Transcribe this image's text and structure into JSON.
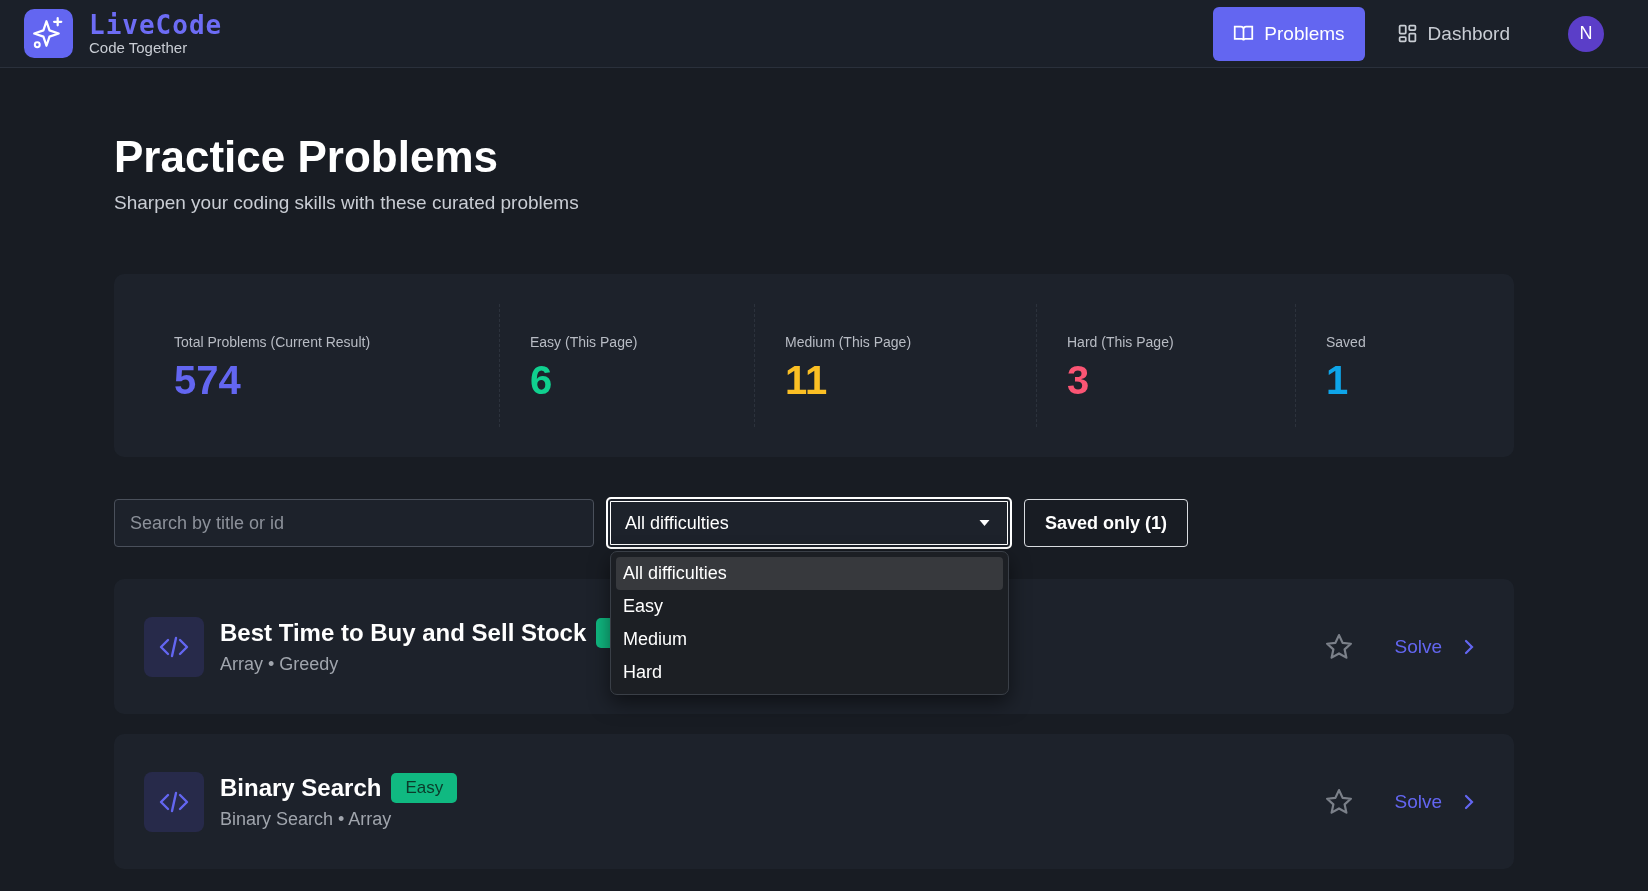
{
  "brand": {
    "name": "LiveCode",
    "tagline": "Code Together"
  },
  "nav": [
    {
      "label": "Problems",
      "selected": true
    },
    {
      "label": "Dashbord",
      "selected": false
    }
  ],
  "avatar": {
    "initial": "N"
  },
  "page": {
    "title": "Practice Problems",
    "subtitle": "Sharpen your coding skills with these curated problems"
  },
  "stats": [
    {
      "label": "Total Problems (Current Result)",
      "value": "574",
      "color": "#6366f1"
    },
    {
      "label": "Easy (This Page)",
      "value": "6",
      "color": "#10d08f"
    },
    {
      "label": "Medium (This Page)",
      "value": "11",
      "color": "#fbbf24"
    },
    {
      "label": "Hard (This Page)",
      "value": "3",
      "color": "#fb5574"
    },
    {
      "label": "Saved",
      "value": "1",
      "color": "#0ea5e9"
    }
  ],
  "filters": {
    "search": {
      "placeholder": "Search by title or id"
    },
    "difficulty": {
      "value": "All difficulties",
      "expanded": true,
      "options": [
        {
          "label": "All difficulties",
          "selected": true
        },
        {
          "label": "Easy",
          "selected": false
        },
        {
          "label": "Medium",
          "selected": false
        },
        {
          "label": "Hard",
          "selected": false
        }
      ]
    },
    "saved_button": "Saved only (1)"
  },
  "problems": [
    {
      "title": "Best Time to Buy and Sell Stock",
      "badge": {
        "color": "#10b981"
      },
      "tags": "Array • Greedy",
      "saved": false,
      "action": "Solve"
    },
    {
      "title": "Binary Search",
      "badge": {
        "label": "Easy",
        "color": "#10b981"
      },
      "tags": "Binary Search • Array",
      "saved": false,
      "action": "Solve"
    }
  ]
}
